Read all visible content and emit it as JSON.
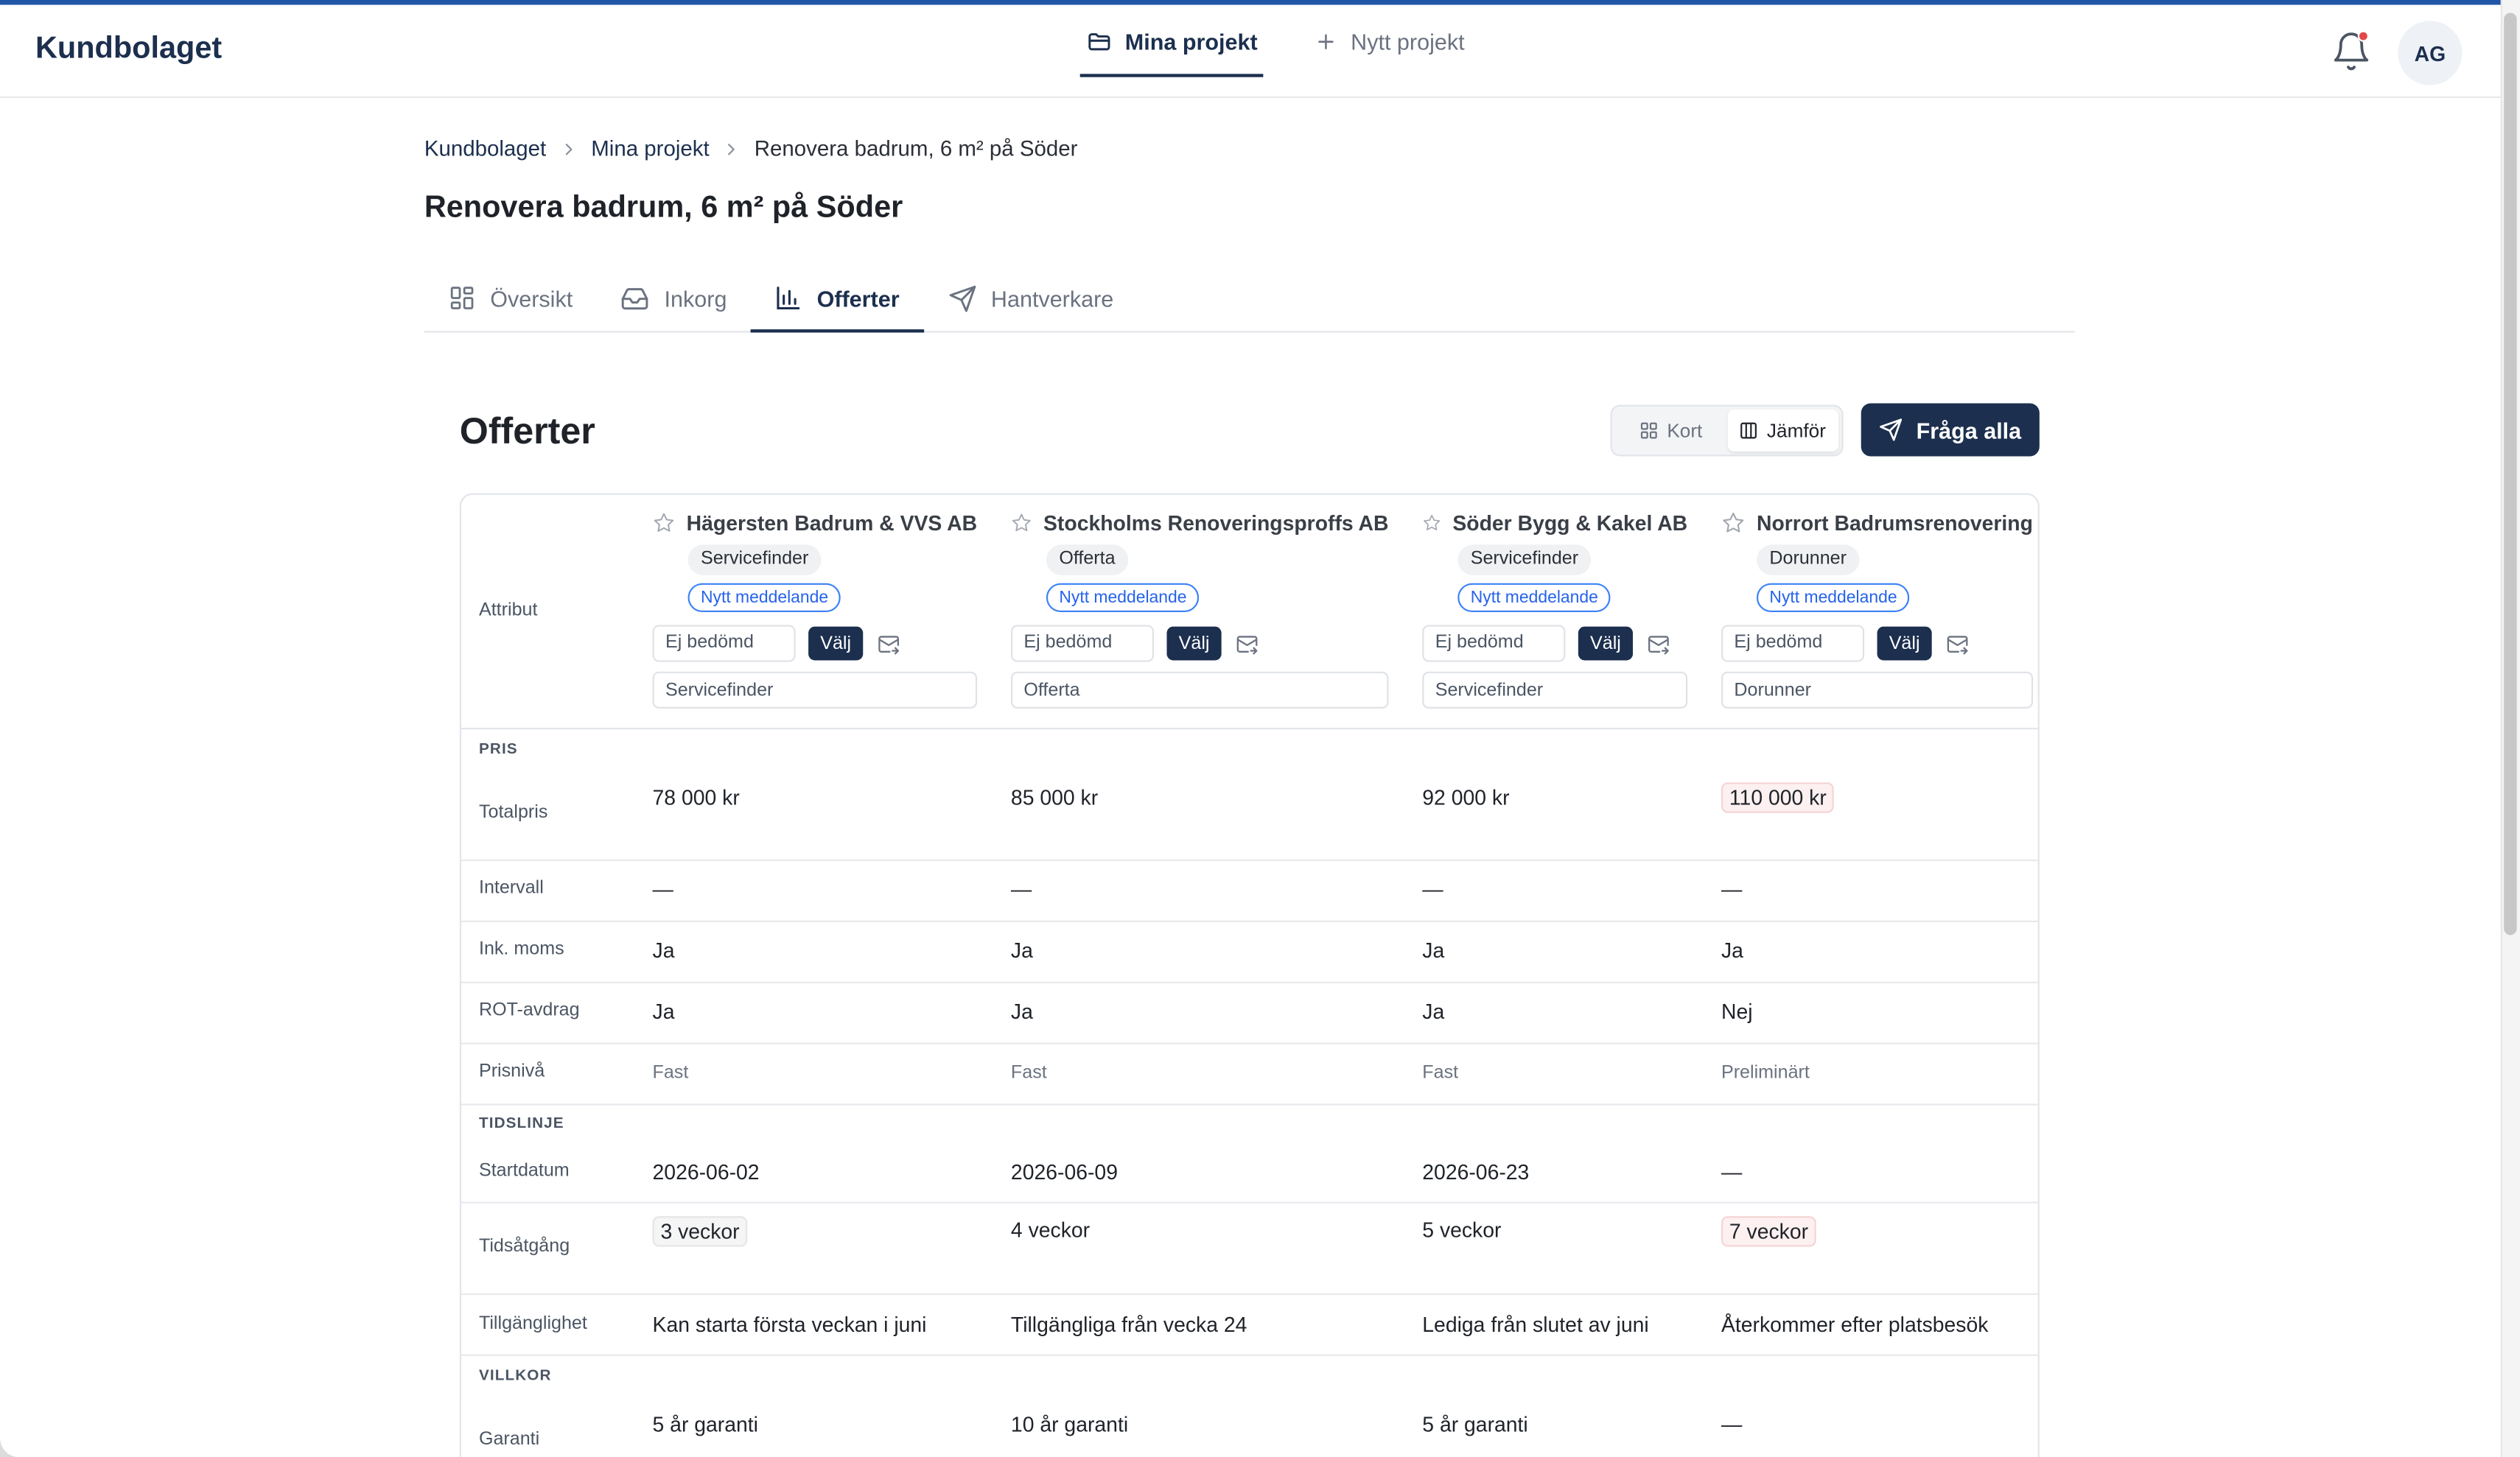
{
  "app": {
    "brand": "Kundbolaget"
  },
  "nav": {
    "items": [
      {
        "label": "Mina projekt",
        "icon": "folder-icon"
      },
      {
        "label": "Nytt projekt",
        "icon": "plus-icon"
      }
    ]
  },
  "user": {
    "initials": "AG"
  },
  "breadcrumb": {
    "items": [
      "Kundbolaget",
      "Mina projekt",
      "Renovera badrum, 6 m² på Söder"
    ]
  },
  "page": {
    "title": "Renovera badrum, 6 m² på Söder"
  },
  "tabs": [
    {
      "label": "Översikt",
      "icon": "grid-icon"
    },
    {
      "label": "Inkorg",
      "icon": "inbox-icon"
    },
    {
      "label": "Offerter",
      "icon": "bar-chart-icon"
    },
    {
      "label": "Hantverkare",
      "icon": "send-icon"
    }
  ],
  "offers": {
    "title": "Offerter",
    "view_toggle": {
      "card": "Kort",
      "compare": "Jämför"
    },
    "ask_all": "Fråga alla",
    "table": {
      "attribute_header": "Attribut",
      "vendors": [
        {
          "name": "Hägersten Badrum & VVS AB",
          "source": "Servicefinder",
          "badge": "Nytt meddelande",
          "rating": "Ej bedömd",
          "choose": "Välj",
          "source_field": "Servicefinder"
        },
        {
          "name": "Stockholms Renoveringsproffs AB",
          "source": "Offerta",
          "badge": "Nytt meddelande",
          "rating": "Ej bedömd",
          "choose": "Välj",
          "source_field": "Offerta"
        },
        {
          "name": "Söder Bygg & Kakel AB",
          "source": "Servicefinder",
          "badge": "Nytt meddelande",
          "rating": "Ej bedömd",
          "choose": "Välj",
          "source_field": "Servicefinder"
        },
        {
          "name": "Norrort Badrumsrenovering",
          "source": "Dorunner",
          "badge": "Nytt meddelande",
          "rating": "Ej bedömd",
          "choose": "Välj",
          "source_field": "Dorunner"
        }
      ],
      "groups": {
        "price": "PRIS",
        "timeline": "TIDSLINJE",
        "terms": "VILLKOR"
      },
      "rows": {
        "totalpris": {
          "label": "Totalpris",
          "values": [
            "78 000 kr",
            "85 000 kr",
            "92 000 kr",
            "110 000 kr"
          ]
        },
        "intervall": {
          "label": "Intervall",
          "values": [
            "—",
            "—",
            "—",
            "—"
          ]
        },
        "moms": {
          "label": "Ink. moms",
          "values": [
            "Ja",
            "Ja",
            "Ja",
            "Ja"
          ]
        },
        "rot": {
          "label": "ROT-avdrag",
          "values": [
            "Ja",
            "Ja",
            "Ja",
            "Nej"
          ]
        },
        "prisniva": {
          "label": "Prisnivå",
          "values": [
            "Fast",
            "Fast",
            "Fast",
            "Preliminärt"
          ]
        },
        "startdatum": {
          "label": "Startdatum",
          "values": [
            "2026-06-02",
            "2026-06-09",
            "2026-06-23",
            "—"
          ]
        },
        "tidsatgang": {
          "label": "Tidsåtgång",
          "values": [
            "3 veckor",
            "4 veckor",
            "5 veckor",
            "7 veckor"
          ]
        },
        "tillganglighet": {
          "label": "Tillgänglighet",
          "values": [
            "Kan starta första veckan i juni",
            "Tillgängliga från vecka 24",
            "Lediga från slutet av juni",
            "Återkommer efter platsbesök"
          ]
        },
        "garanti": {
          "label": "Garanti",
          "values": [
            "5 år garanti",
            "10 år garanti",
            "5 år garanti",
            "—"
          ]
        }
      }
    }
  }
}
